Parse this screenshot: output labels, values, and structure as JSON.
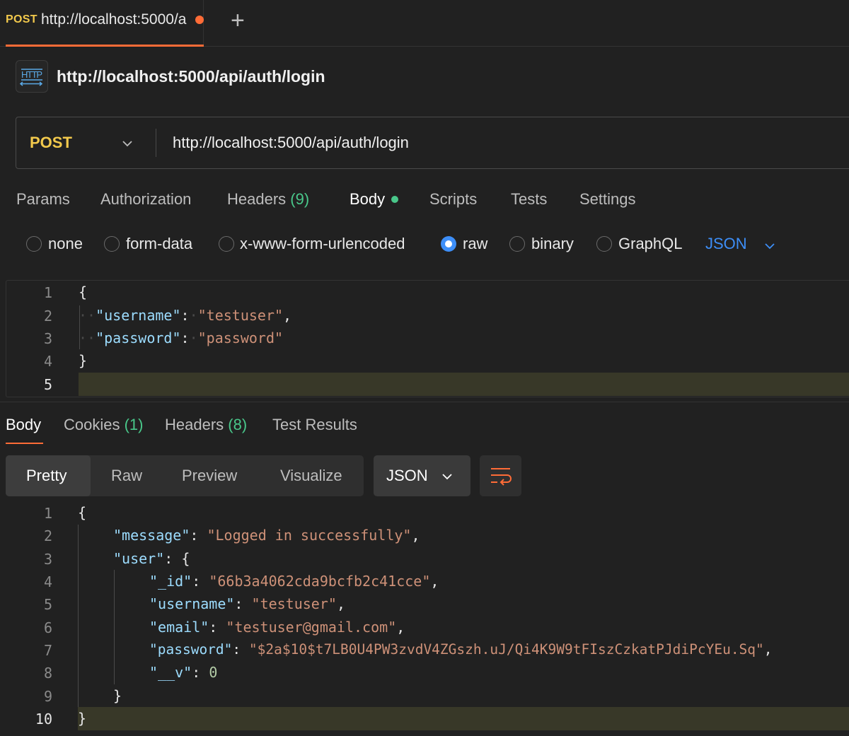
{
  "tab": {
    "method": "POST",
    "url": "http://localhost:5000/a",
    "add_icon": "plus-icon"
  },
  "request": {
    "title": "http://localhost:5000/api/auth/login",
    "method": "POST",
    "url": "http://localhost:5000/api/auth/login"
  },
  "request_tabs": [
    {
      "label": "Params"
    },
    {
      "label": "Authorization"
    },
    {
      "label": "Headers",
      "count": "(9)"
    },
    {
      "label": "Body"
    },
    {
      "label": "Scripts"
    },
    {
      "label": "Tests"
    },
    {
      "label": "Settings"
    }
  ],
  "body_types": [
    "none",
    "form-data",
    "x-www-form-urlencoded",
    "raw",
    "binary",
    "GraphQL"
  ],
  "body_type_selected": "raw",
  "body_language": "JSON",
  "request_body_lines": [
    "{",
    "  \"username\": \"testuser\",",
    "  \"password\": \"password\"",
    "}",
    ""
  ],
  "request_line_numbers": [
    "1",
    "2",
    "3",
    "4",
    "5"
  ],
  "response_tabs": [
    {
      "label": "Body"
    },
    {
      "label": "Cookies",
      "count": "(1)"
    },
    {
      "label": "Headers",
      "count": "(8)"
    },
    {
      "label": "Test Results"
    }
  ],
  "view_modes": [
    "Pretty",
    "Raw",
    "Preview",
    "Visualize"
  ],
  "view_mode_selected": "Pretty",
  "response_format": "JSON",
  "response_line_numbers": [
    "1",
    "2",
    "3",
    "4",
    "5",
    "6",
    "7",
    "8",
    "9",
    "10"
  ],
  "response": {
    "message": "Logged in successfully",
    "user": {
      "_id": "66b3a4062cda9bcfb2c41cce",
      "username": "testuser",
      "email": "testuser@gmail.com",
      "password": "$2a$10$t7LB0U4PW3zvdV4ZGszh.uJ/Qi4K9W9tFIszCzkatPJdiPcYEu.Sq",
      "__v": "0"
    }
  },
  "colors": {
    "accent": "#ff6c37",
    "method_post": "#f2c94c",
    "count_green": "#49c78a",
    "link_blue": "#3d8ef7"
  }
}
